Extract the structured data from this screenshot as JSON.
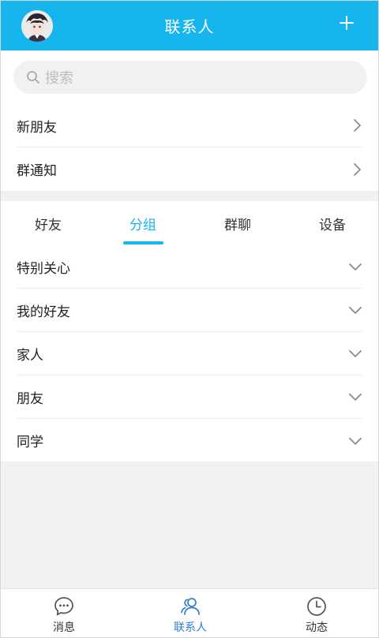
{
  "header": {
    "title": "联系人"
  },
  "search": {
    "placeholder": "搜索"
  },
  "top_list": [
    {
      "label": "新朋友"
    },
    {
      "label": "群通知"
    }
  ],
  "tabs": [
    {
      "label": "好友",
      "active": false
    },
    {
      "label": "分组",
      "active": true
    },
    {
      "label": "群聊",
      "active": false
    },
    {
      "label": "设备",
      "active": false
    }
  ],
  "groups": [
    {
      "label": "特别关心"
    },
    {
      "label": "我的好友"
    },
    {
      "label": "家人"
    },
    {
      "label": "朋友"
    },
    {
      "label": "同学"
    }
  ],
  "bottom_nav": [
    {
      "label": "消息",
      "icon": "chat-bubble-icon",
      "active": false
    },
    {
      "label": "联系人",
      "icon": "contacts-icon",
      "active": true
    },
    {
      "label": "动态",
      "icon": "clock-icon",
      "active": false
    }
  ],
  "colors": {
    "accent": "#16b5ee",
    "nav_active": "#2f7fd2",
    "background": "#f1f1f1"
  }
}
